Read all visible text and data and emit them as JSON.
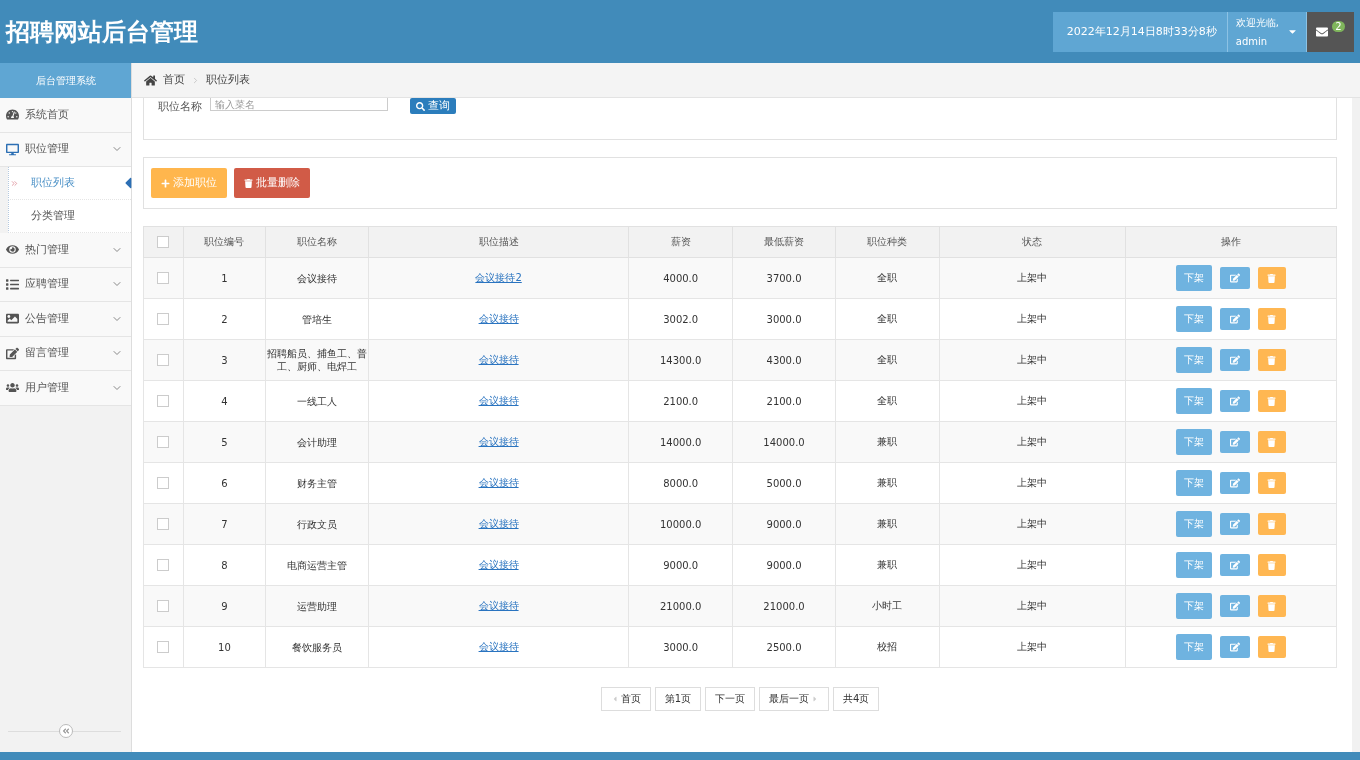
{
  "header": {
    "title": "招聘网站后台管理",
    "datetime": "2022年12月14日8时33分8秒",
    "welcome": "欢迎光临,",
    "user": "admin",
    "message_count": "2"
  },
  "sidebar": {
    "title": "后台管理系统",
    "items": [
      {
        "label": "系统首页",
        "kind": "link"
      },
      {
        "label": "职位管理",
        "kind": "group",
        "children": [
          {
            "label": "职位列表",
            "selected": true
          },
          {
            "label": "分类管理",
            "selected": false
          }
        ]
      },
      {
        "label": "热门管理",
        "kind": "group"
      },
      {
        "label": "应聘管理",
        "kind": "group"
      },
      {
        "label": "公告管理",
        "kind": "group"
      },
      {
        "label": "留言管理",
        "kind": "group"
      },
      {
        "label": "用户管理",
        "kind": "group"
      }
    ]
  },
  "breadcrumb": [
    "首页",
    "职位列表"
  ],
  "search": {
    "label": "职位名称",
    "placeholder": "输入菜名",
    "button": "查询"
  },
  "toolbar": {
    "add": "添加职位",
    "batch_delete": "批量删除"
  },
  "table": {
    "columns": [
      "职位编号",
      "职位名称",
      "职位描述",
      "薪资",
      "最低薪资",
      "职位种类",
      "状态",
      "操作"
    ],
    "all_checked": false,
    "rows": [
      {
        "checked": false,
        "id": "1",
        "name": "会议接待",
        "description": "会议接待2",
        "salary": "4000.0",
        "min_salary": "3700.0",
        "type": "全职",
        "status": "上架中",
        "action": "下架"
      },
      {
        "checked": false,
        "id": "2",
        "name": "管培生",
        "description": "会议接待",
        "salary": "3002.0",
        "min_salary": "3000.0",
        "type": "全职",
        "status": "上架中",
        "action": "下架"
      },
      {
        "checked": false,
        "id": "3",
        "name": "招聘船员、捕鱼工、普工、厨师、电焊工",
        "description": "会议接待",
        "salary": "14300.0",
        "min_salary": "4300.0",
        "type": "全职",
        "status": "上架中",
        "action": "下架"
      },
      {
        "checked": false,
        "id": "4",
        "name": "一线工人",
        "description": "会议接待",
        "salary": "2100.0",
        "min_salary": "2100.0",
        "type": "全职",
        "status": "上架中",
        "action": "下架"
      },
      {
        "checked": false,
        "id": "5",
        "name": "会计助理",
        "description": "会议接待",
        "salary": "14000.0",
        "min_salary": "14000.0",
        "type": "兼职",
        "status": "上架中",
        "action": "下架"
      },
      {
        "checked": false,
        "id": "6",
        "name": "财务主管",
        "description": "会议接待",
        "salary": "8000.0",
        "min_salary": "5000.0",
        "type": "兼职",
        "status": "上架中",
        "action": "下架"
      },
      {
        "checked": false,
        "id": "7",
        "name": "行政文员",
        "description": "会议接待",
        "salary": "10000.0",
        "min_salary": "9000.0",
        "type": "兼职",
        "status": "上架中",
        "action": "下架"
      },
      {
        "checked": false,
        "id": "8",
        "name": "电商运营主管",
        "description": "会议接待",
        "salary": "9000.0",
        "min_salary": "9000.0",
        "type": "兼职",
        "status": "上架中",
        "action": "下架"
      },
      {
        "checked": false,
        "id": "9",
        "name": "运营助理",
        "description": "会议接待",
        "salary": "21000.0",
        "min_salary": "21000.0",
        "type": "小时工",
        "status": "上架中",
        "action": "下架"
      },
      {
        "checked": false,
        "id": "10",
        "name": "餐饮服务员",
        "description": "会议接待",
        "salary": "3000.0",
        "min_salary": "2500.0",
        "type": "校招",
        "status": "上架中",
        "action": "下架"
      }
    ]
  },
  "pagination": [
    "首页",
    "第1页",
    "下一页",
    "最后一页",
    "共4页"
  ]
}
